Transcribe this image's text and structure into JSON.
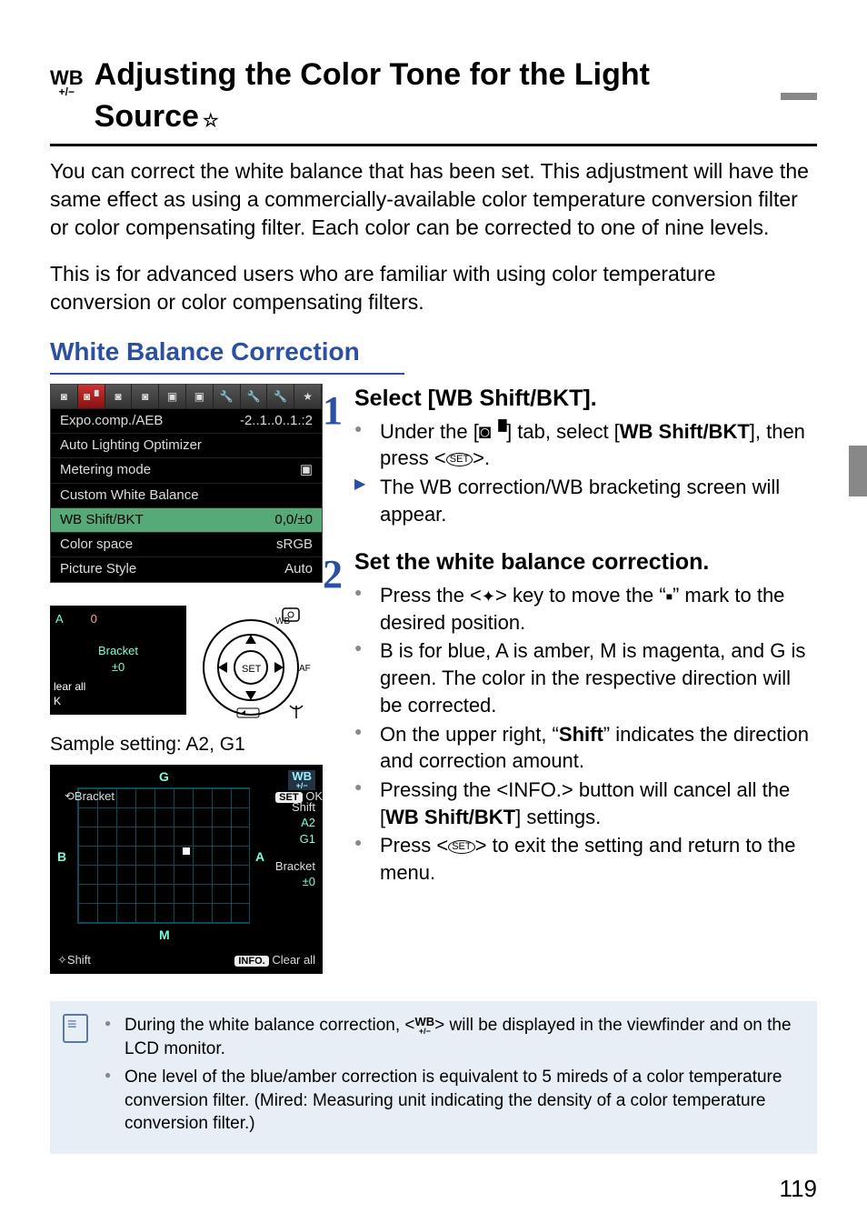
{
  "title_icon_top": "WB",
  "title_icon_bottom": "+/−",
  "title": "Adjusting the Color Tone for the Light Source",
  "star": "☆",
  "intro1": "You can correct the white balance that has been set. This adjustment will have the same effect as using a commercially-available color temperature conversion filter or color compensating filter. Each color can be corrected to one of nine levels.",
  "intro2": "This is for advanced users who are familiar with using color temperature conversion or color compensating filters.",
  "h2": "White Balance Correction",
  "menu": {
    "rows": [
      {
        "l": "Expo.comp./AEB",
        "r": "-2..1..0..1.:2"
      },
      {
        "l": "Auto Lighting Optimizer",
        "r": ""
      },
      {
        "l": "Metering mode",
        "r": "▣"
      },
      {
        "l": "Custom White Balance",
        "r": ""
      },
      {
        "l": "WB Shift/BKT",
        "r": "0,0/±0",
        "sel": true
      },
      {
        "l": "Color space",
        "r": "sRGB"
      },
      {
        "l": "Picture Style",
        "r": "Auto"
      }
    ]
  },
  "lcd": {
    "A": "A",
    "zero": "0",
    "bracket": "Bracket",
    "pm": "±0",
    "clear": "lear all",
    "ok": "K",
    "wb": "WB"
  },
  "caption": "Sample setting: A2, G1",
  "grid": {
    "G": "G",
    "B": "B",
    "A": "A",
    "M": "M",
    "wb": "WB",
    "shift_lbl": "Shift",
    "a2": "A2",
    "g1": "G1",
    "brk": "Bracket",
    "pm": "±0",
    "f_shift": "Shift",
    "f_brk": "Bracket",
    "clear": "Clear all",
    "ok": "OK",
    "info": "INFO.",
    "set": "SET"
  },
  "step1": {
    "num": "1",
    "head": "Select [WB Shift/BKT].",
    "b1a": "Under the [",
    "b1b": "] tab, select [",
    "b1c": "WB Shift/BKT",
    "b1d": "], then press <",
    "b1e": ">.",
    "cam": "◙▝",
    "b2": "The WB correction/WB bracketing screen will appear."
  },
  "step2": {
    "num": "2",
    "head": "Set the white balance correction.",
    "b1a": "Press the <",
    "b1b": "> key to move the “",
    "b1c": "” mark to the desired position.",
    "b2": "B is for blue, A is amber, M is magenta, and G is green. The color in the respective direction will be corrected.",
    "b3a": "On the upper right, “",
    "b3b": "Shift",
    "b3c": "” indicates the direction and correction amount.",
    "b4a": "Pressing the <",
    "b4b": "INFO.",
    "b4c": "> button will cancel all the [",
    "b4d": "WB Shift/BKT",
    "b4e": "] settings.",
    "b5a": "Press <",
    "b5b": "> to exit the setting and return to the menu."
  },
  "notes": {
    "n1a": "During the white balance correction, <",
    "n1b": "> will be displayed in the viewfinder and on the LCD monitor.",
    "n2": "One level of the blue/amber correction is equivalent to 5 mireds of a color temperature conversion filter. (Mired: Measuring unit indicating the density of a color temperature conversion filter.)"
  },
  "page": "119"
}
